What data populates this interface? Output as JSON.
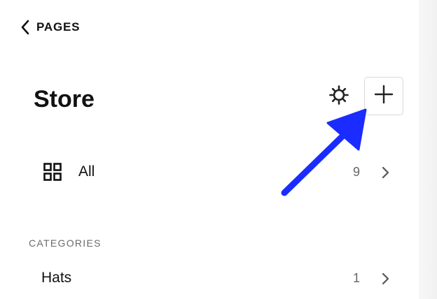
{
  "nav": {
    "back_label": "PAGES",
    "back_icon": "chevron-left-icon"
  },
  "header": {
    "title": "Store",
    "settings_icon": "gear-icon",
    "add_icon": "plus-icon"
  },
  "all_row": {
    "icon": "grid-icon",
    "label": "All",
    "count": "9"
  },
  "categories": {
    "heading": "CATEGORIES",
    "items": [
      {
        "label": "Hats",
        "count": "1"
      }
    ]
  },
  "annotation": {
    "arrow_color": "#1a2cff",
    "target": "add-button"
  }
}
